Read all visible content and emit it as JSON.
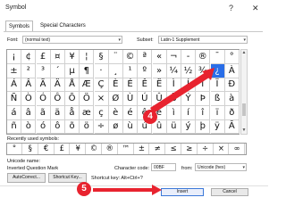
{
  "window": {
    "title": "Symbol",
    "help": "?",
    "close": "✕"
  },
  "tabs": [
    {
      "label": "Symbols",
      "active": true
    },
    {
      "label": "Special Characters",
      "active": false
    }
  ],
  "font": {
    "label": "Font:",
    "value": "(normal text)"
  },
  "subset": {
    "label": "Subset:",
    "value": "Latin-1 Supplement"
  },
  "grid": {
    "rows": [
      [
        "¡",
        "¢",
        "£",
        "¤",
        "¥",
        "¦",
        "§",
        "¨",
        "©",
        "ª",
        "«",
        "¬",
        "-",
        "®",
        "¯",
        "°"
      ],
      [
        "±",
        "²",
        "³",
        "´",
        "µ",
        "¶",
        "·",
        "¸",
        "¹",
        "º",
        "»",
        "¼",
        "½",
        "¾",
        "¿",
        "À"
      ],
      [
        "Á",
        "Â",
        "Ã",
        "Ä",
        "Å",
        "Æ",
        "Ç",
        "È",
        "É",
        "Ê",
        "Ë",
        "Ì",
        "Í",
        "Î",
        "Ï",
        "Ð"
      ],
      [
        "Ñ",
        "Ò",
        "Ó",
        "Ô",
        "Õ",
        "Ö",
        "×",
        "Ø",
        "Ù",
        "Ú",
        "Û",
        "Ü",
        "Ý",
        "Þ",
        "ß",
        "à"
      ],
      [
        "á",
        "â",
        "ã",
        "ä",
        "å",
        "æ",
        "ç",
        "è",
        "é",
        "ê",
        "ë",
        "ì",
        "í",
        "î",
        "ï",
        "ð"
      ],
      [
        "ñ",
        "ò",
        "ó",
        "ô",
        "õ",
        "ö",
        "÷",
        "ø",
        "ù",
        "ú",
        "û",
        "ü",
        "ý",
        "þ",
        "ÿ",
        "Ā"
      ]
    ],
    "selected": {
      "row": 1,
      "col": 14
    }
  },
  "recent": {
    "label": "Recently used symbols:",
    "symbols": [
      "°",
      "§",
      "€",
      "£",
      "¥",
      "©",
      "®",
      "™",
      "±",
      "≠",
      "≤",
      "≥",
      "÷",
      "×",
      "∞"
    ]
  },
  "unicode_name": {
    "label": "Unicode name:",
    "value": "Inverted Question Mark"
  },
  "char_code": {
    "label": "Character code:",
    "value": "00BF"
  },
  "from": {
    "label": "from:",
    "value": "Unicode (hex)"
  },
  "buttons": {
    "autocorrect": "AutoCorrect...",
    "shortcut": "Shortcut Key...",
    "insert": "Insert",
    "cancel": "Cancel"
  },
  "shortcut_text": "Shortcut key: Alt+Ctrl+?",
  "annotations": {
    "step4": "4",
    "step5": "5",
    "color": "#e8232f"
  }
}
